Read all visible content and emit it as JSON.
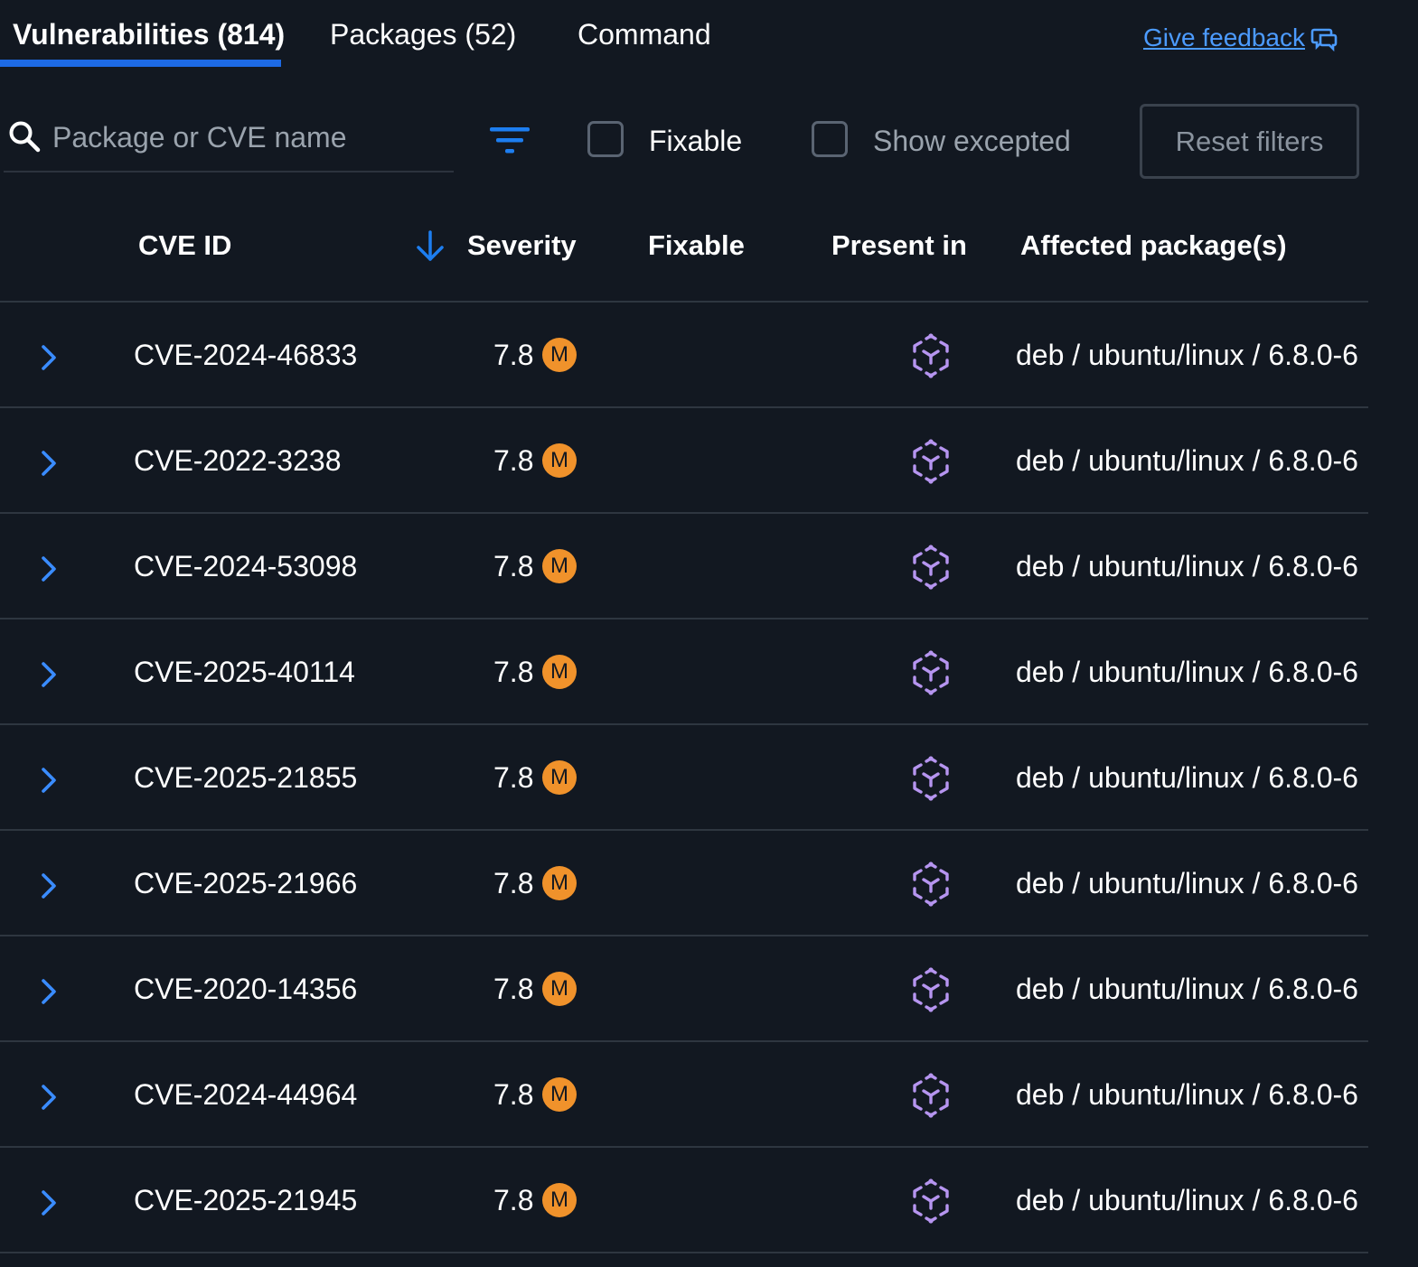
{
  "tabs": [
    {
      "label": "Vulnerabilities (814)",
      "active": true
    },
    {
      "label": "Packages (52)",
      "active": false
    },
    {
      "label": "Command",
      "active": false
    }
  ],
  "feedback": {
    "label": "Give feedback"
  },
  "toolbar": {
    "search_placeholder": "Package or CVE name",
    "search_value": "",
    "fixable_label": "Fixable",
    "fixable_checked": false,
    "show_excepted_label": "Show excepted",
    "show_excepted_checked": false,
    "reset_label": "Reset filters"
  },
  "table": {
    "columns": {
      "cve_id": "CVE ID",
      "severity": "Severity",
      "fixable": "Fixable",
      "present_in": "Present in",
      "affected": "Affected package(s)"
    },
    "sort": {
      "column": "severity",
      "direction": "descending"
    },
    "rows": [
      {
        "cve": "CVE-2024-46833",
        "score": "7.8",
        "badge": "M",
        "fixable": "",
        "package": "deb / ubuntu/linux / 6.8.0-6"
      },
      {
        "cve": "CVE-2022-3238",
        "score": "7.8",
        "badge": "M",
        "fixable": "",
        "package": "deb / ubuntu/linux / 6.8.0-6"
      },
      {
        "cve": "CVE-2024-53098",
        "score": "7.8",
        "badge": "M",
        "fixable": "",
        "package": "deb / ubuntu/linux / 6.8.0-6"
      },
      {
        "cve": "CVE-2025-40114",
        "score": "7.8",
        "badge": "M",
        "fixable": "",
        "package": "deb / ubuntu/linux / 6.8.0-6"
      },
      {
        "cve": "CVE-2025-21855",
        "score": "7.8",
        "badge": "M",
        "fixable": "",
        "package": "deb / ubuntu/linux / 6.8.0-6"
      },
      {
        "cve": "CVE-2025-21966",
        "score": "7.8",
        "badge": "M",
        "fixable": "",
        "package": "deb / ubuntu/linux / 6.8.0-6"
      },
      {
        "cve": "CVE-2020-14356",
        "score": "7.8",
        "badge": "M",
        "fixable": "",
        "package": "deb / ubuntu/linux / 6.8.0-6"
      },
      {
        "cve": "CVE-2024-44964",
        "score": "7.8",
        "badge": "M",
        "fixable": "",
        "package": "deb / ubuntu/linux / 6.8.0-6"
      },
      {
        "cve": "CVE-2025-21945",
        "score": "7.8",
        "badge": "M",
        "fixable": "",
        "package": "deb / ubuntu/linux / 6.8.0-6"
      }
    ]
  },
  "icons": {
    "search": "search-icon",
    "filter": "filter-icon",
    "sort": "arrow-down-icon",
    "expand": "chevron-right-icon",
    "present_in": "base-image-layer-icon",
    "feedback": "chat-bubble-icon"
  },
  "colors": {
    "background": "#121821",
    "accent": "#1d6ae5",
    "link": "#4c9bff",
    "severity_medium": "#f0922b",
    "layer_icon": "#b695f0"
  }
}
